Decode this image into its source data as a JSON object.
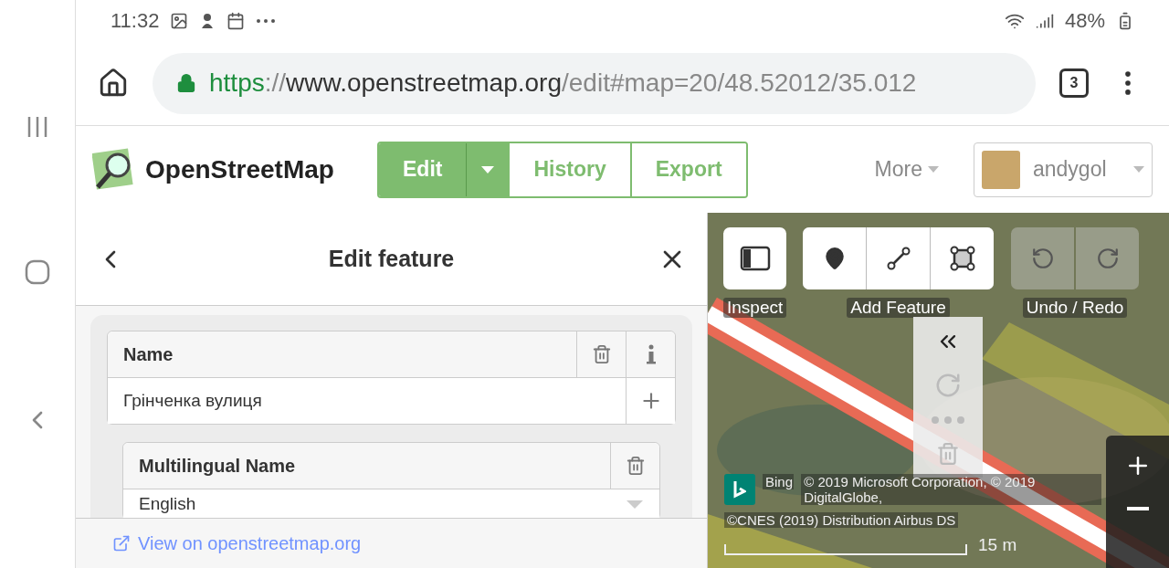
{
  "status_bar": {
    "time": "11:32",
    "battery": "48%"
  },
  "browser": {
    "url": {
      "scheme": "https",
      "separator": "://",
      "host": "www.openstreetmap.org",
      "path": "/edit#map=20/48.52012/35.012"
    },
    "tab_count": "3"
  },
  "site": {
    "logo_text": "OpenStreetMap",
    "nav": [
      {
        "label": "Edit",
        "selected": true,
        "has_dropdown": true
      },
      {
        "label": "History",
        "selected": false,
        "has_dropdown": false
      },
      {
        "label": "Export",
        "selected": false,
        "has_dropdown": false
      }
    ],
    "more": "More",
    "user": "andygol"
  },
  "panel": {
    "title": "Edit feature",
    "name_field": {
      "label": "Name",
      "value": "Грінченка вулиця"
    },
    "multilingual_field": {
      "label": "Multilingual Name",
      "language": "English"
    },
    "footer_link": "View on openstreetmap.org"
  },
  "map": {
    "toolbar": [
      {
        "label": "Inspect",
        "kind": "inspect"
      },
      {
        "label": "Add Feature",
        "kind": "add"
      },
      {
        "label": "Undo / Redo",
        "kind": "undo"
      }
    ],
    "attribution": {
      "provider": "Bing",
      "copyright": "© 2019 Microsoft Corporation, © 2019 DigitalGlobe,",
      "line2": "©CNES (2019) Distribution Airbus DS"
    },
    "scale": "15 m"
  }
}
